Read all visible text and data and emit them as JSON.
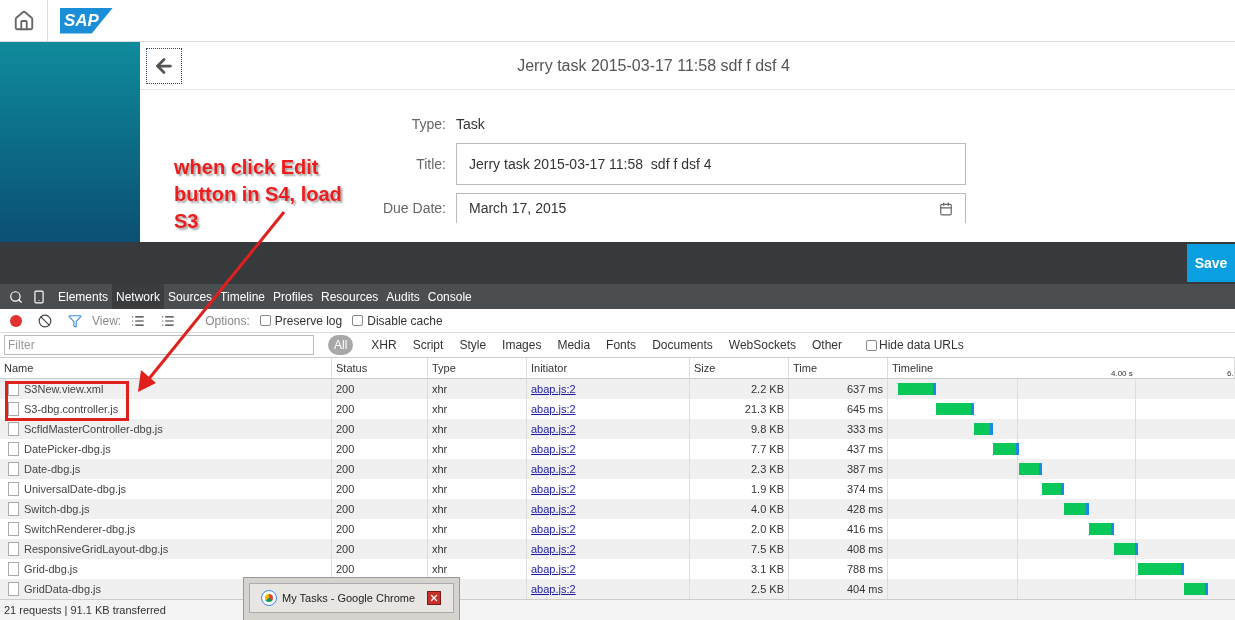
{
  "app_header": {
    "logo": "SAP"
  },
  "page": {
    "title": "Jerry task 2015-03-17 11:58 sdf f dsf 4",
    "form": [
      {
        "kind": "text",
        "label": "Type:",
        "value": "Task"
      },
      {
        "kind": "input",
        "label": "Title:",
        "value": "Jerry task 2015-03-17 11:58  sdf f dsf 4"
      },
      {
        "kind": "date",
        "label": "Due Date:",
        "value": "March 17, 2015"
      }
    ]
  },
  "footer": {
    "save_button": "Save"
  },
  "devtools": {
    "tabs": [
      {
        "label": "Elements",
        "selected": false
      },
      {
        "label": "Network",
        "selected": true
      },
      {
        "label": "Sources",
        "selected": false
      },
      {
        "label": "Timeline",
        "selected": false
      },
      {
        "label": "Profiles",
        "selected": false
      },
      {
        "label": "Resources",
        "selected": false
      },
      {
        "label": "Audits",
        "selected": false
      },
      {
        "label": "Console",
        "selected": false
      }
    ],
    "toolbar": {
      "recording": true,
      "filter_active": true,
      "view_label": "View:",
      "options_label": "Options:",
      "preserve_log": {
        "label": "Preserve log",
        "checked": false
      },
      "disable_cache": {
        "label": "Disable cache",
        "checked": false
      }
    },
    "filter": {
      "placeholder": "Filter",
      "types": [
        {
          "label": "All",
          "selected": true
        },
        {
          "label": "XHR",
          "selected": false
        },
        {
          "label": "Script",
          "selected": false
        },
        {
          "label": "Style",
          "selected": false
        },
        {
          "label": "Images",
          "selected": false
        },
        {
          "label": "Media",
          "selected": false
        },
        {
          "label": "Fonts",
          "selected": false
        },
        {
          "label": "Documents",
          "selected": false
        },
        {
          "label": "WebSockets",
          "selected": false
        },
        {
          "label": "Other",
          "selected": false
        }
      ],
      "hide_data_urls": {
        "label": "Hide data URLs",
        "checked": false
      }
    },
    "columns": [
      "Name",
      "Status",
      "Type",
      "Initiator",
      "Size",
      "Time",
      "Timeline"
    ],
    "timeline_ticks": [
      "4.00 s",
      "6."
    ],
    "rows": [
      {
        "name": "S3New.view.xml",
        "status": "200",
        "type": "xhr",
        "initiator": "abap.js:2",
        "size": "2.2 KB",
        "time": "637 ms"
      },
      {
        "name": "S3-dbg.controller.js",
        "status": "200",
        "type": "xhr",
        "initiator": "abap.js:2",
        "size": "21.3 KB",
        "time": "645 ms"
      },
      {
        "name": "ScfldMasterController-dbg.js",
        "status": "200",
        "type": "xhr",
        "initiator": "abap.js:2",
        "size": "9.8 KB",
        "time": "333 ms"
      },
      {
        "name": "DatePicker-dbg.js",
        "status": "200",
        "type": "xhr",
        "initiator": "abap.js:2",
        "size": "7.7 KB",
        "time": "437 ms"
      },
      {
        "name": "Date-dbg.js",
        "status": "200",
        "type": "xhr",
        "initiator": "abap.js:2",
        "size": "2.3 KB",
        "time": "387 ms"
      },
      {
        "name": "UniversalDate-dbg.js",
        "status": "200",
        "type": "xhr",
        "initiator": "abap.js:2",
        "size": "1.9 KB",
        "time": "374 ms"
      },
      {
        "name": "Switch-dbg.js",
        "status": "200",
        "type": "xhr",
        "initiator": "abap.js:2",
        "size": "4.0 KB",
        "time": "428 ms"
      },
      {
        "name": "SwitchRenderer-dbg.js",
        "status": "200",
        "type": "xhr",
        "initiator": "abap.js:2",
        "size": "2.0 KB",
        "time": "416 ms"
      },
      {
        "name": "ResponsiveGridLayout-dbg.js",
        "status": "200",
        "type": "xhr",
        "initiator": "abap.js:2",
        "size": "7.5 KB",
        "time": "408 ms"
      },
      {
        "name": "Grid-dbg.js",
        "status": "200",
        "type": "xhr",
        "initiator": "abap.js:2",
        "size": "3.1 KB",
        "time": "788 ms"
      },
      {
        "name": "GridData-dbg.js",
        "initiator": "abap.js:2",
        "size": "2.5 KB",
        "time": "404 ms"
      }
    ],
    "status_bar": "21 requests | 91.1 KB transferred"
  },
  "annotation": {
    "text": "when click Edit button in S4, load S3"
  },
  "taskbar_preview": {
    "title": "My Tasks - Google Chrome"
  }
}
